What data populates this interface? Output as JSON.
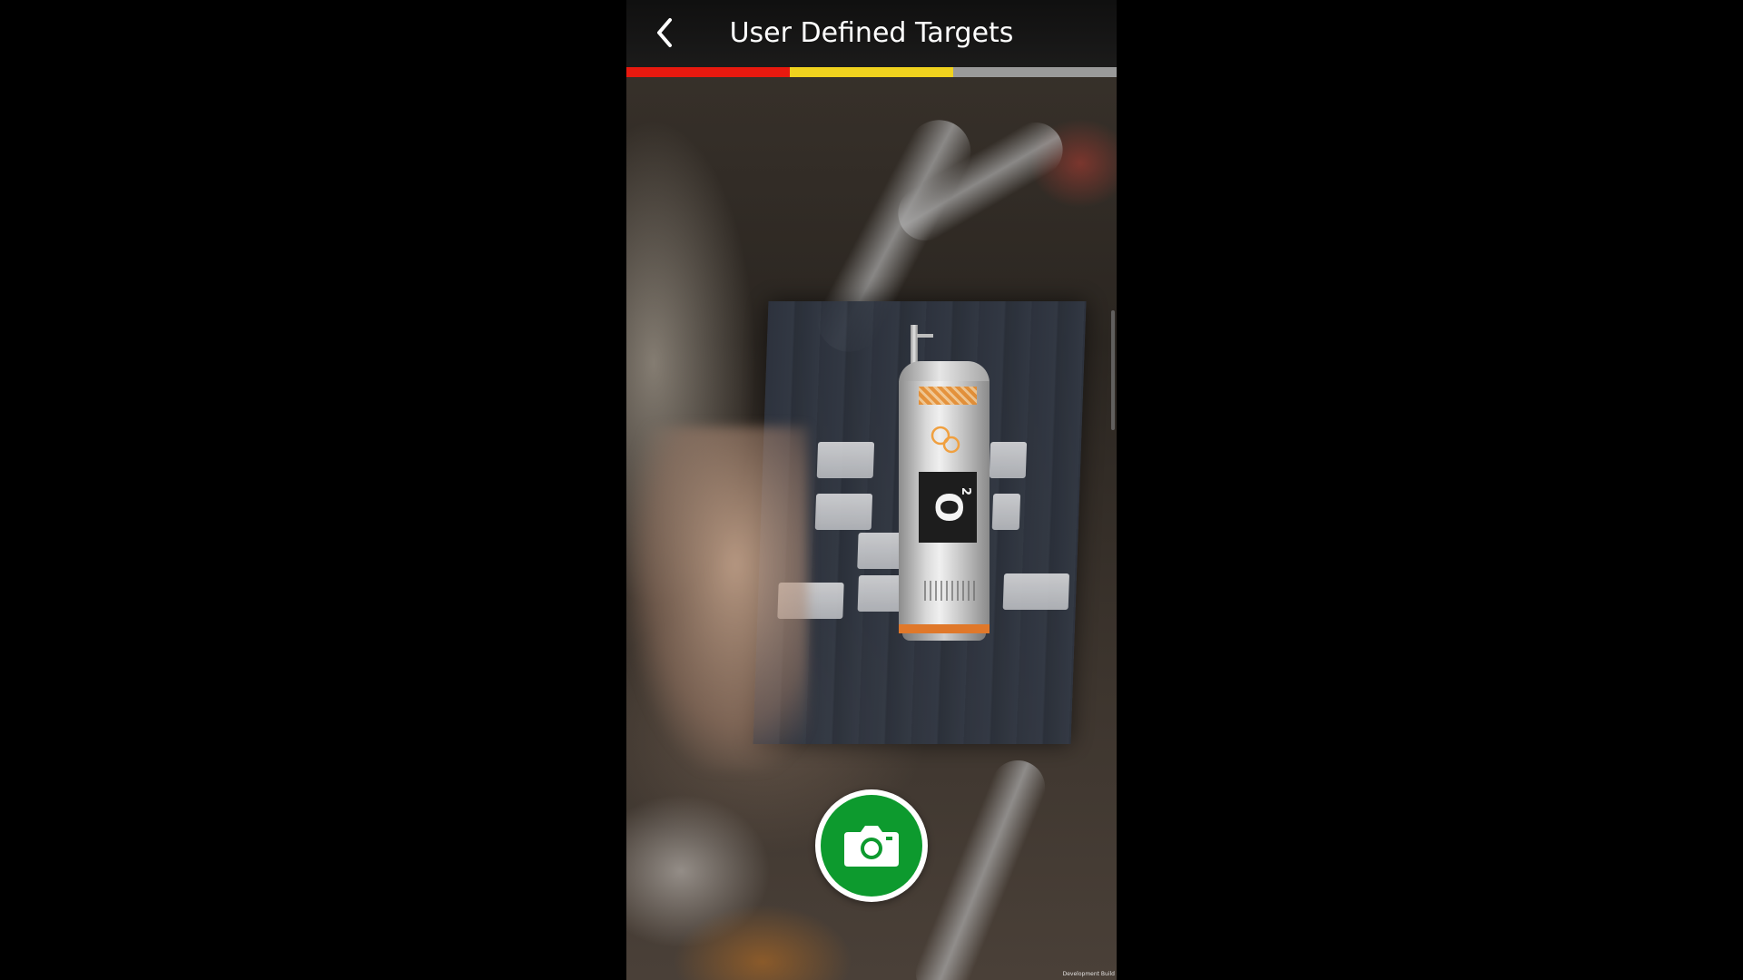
{
  "header": {
    "back_icon": "chevron-left-icon",
    "title": "User Defined Targets"
  },
  "tracking_quality": {
    "segments": [
      {
        "color": "#e8190f",
        "fraction": 0.3333
      },
      {
        "color": "#f0d21e",
        "fraction": 0.3333
      },
      {
        "color": "#9a9a9a",
        "fraction": 0.3334
      }
    ]
  },
  "augmented_object": {
    "label_text": "O",
    "label_subscript": "2"
  },
  "capture_button": {
    "icon": "camera-icon",
    "color": "#0d9a2e"
  },
  "footer": {
    "build_label": "Development Build"
  }
}
